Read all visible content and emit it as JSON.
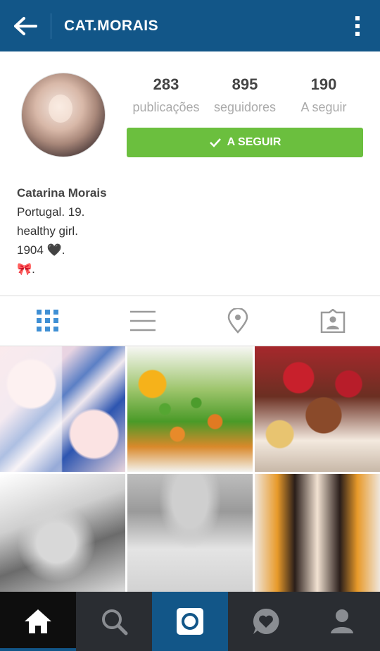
{
  "header": {
    "username": "CAT.MORAIS",
    "back_icon": "arrow-left-icon",
    "more_icon": "kebab-menu-icon"
  },
  "profile": {
    "stats": [
      {
        "value": "283",
        "label": "publicações"
      },
      {
        "value": "895",
        "label": "seguidores"
      },
      {
        "value": "190",
        "label": "A seguir"
      }
    ],
    "follow_button": "A SEGUIR",
    "name": "Catarina Morais",
    "bio_lines": [
      "Portugal. 19.",
      "healthy girl.",
      "1904 🖤.",
      "🎀."
    ]
  },
  "tabs": [
    {
      "icon": "grid-icon",
      "active": true
    },
    {
      "icon": "list-icon",
      "active": false
    },
    {
      "icon": "location-pin-icon",
      "active": false
    },
    {
      "icon": "tagged-photos-icon",
      "active": false
    }
  ],
  "bottom_nav": [
    {
      "icon": "home-icon",
      "active": true
    },
    {
      "icon": "search-icon",
      "active": false
    },
    {
      "icon": "camera-icon",
      "active": false
    },
    {
      "icon": "activity-heart-icon",
      "active": false
    },
    {
      "icon": "profile-icon",
      "active": false
    }
  ],
  "colors": {
    "header": "#125688",
    "follow_button": "#6bbf3e",
    "active_tab": "#3f8fd4",
    "bottom_nav": "#2a2d32"
  }
}
